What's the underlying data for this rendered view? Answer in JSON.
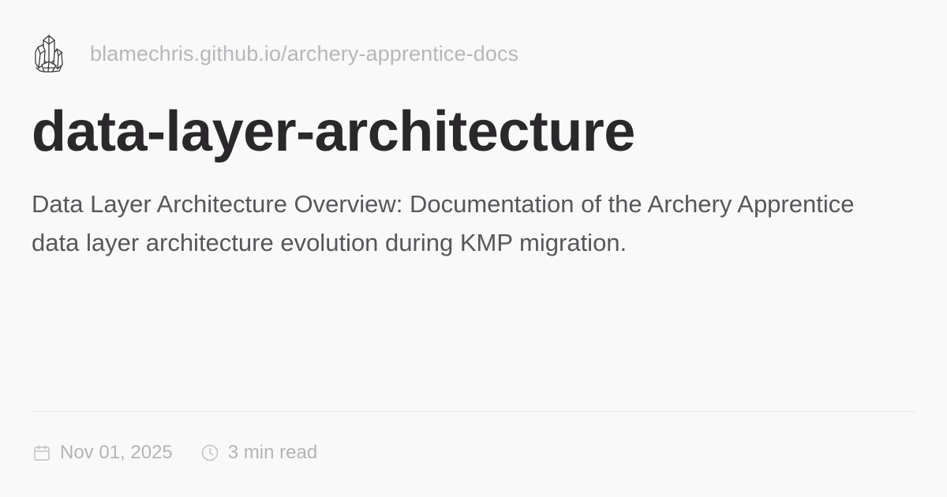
{
  "site": {
    "url": "blamechris.github.io/archery-apprentice-docs",
    "logo_icon": "crystal-cluster-icon"
  },
  "page": {
    "title": "data-layer-architecture",
    "description": "Data Layer Architecture Overview: Documentation of the Archery Apprentice data layer architecture evolution during KMP migration."
  },
  "meta": {
    "date": "Nov 01, 2025",
    "date_icon": "calendar-icon",
    "read_time": "3 min read",
    "read_time_icon": "clock-icon"
  },
  "colors": {
    "background": "#faf9fa",
    "title": "#2a282b",
    "body_text": "#58565a",
    "muted_text": "#b8b6ba",
    "divider": "#e6e4e7"
  }
}
